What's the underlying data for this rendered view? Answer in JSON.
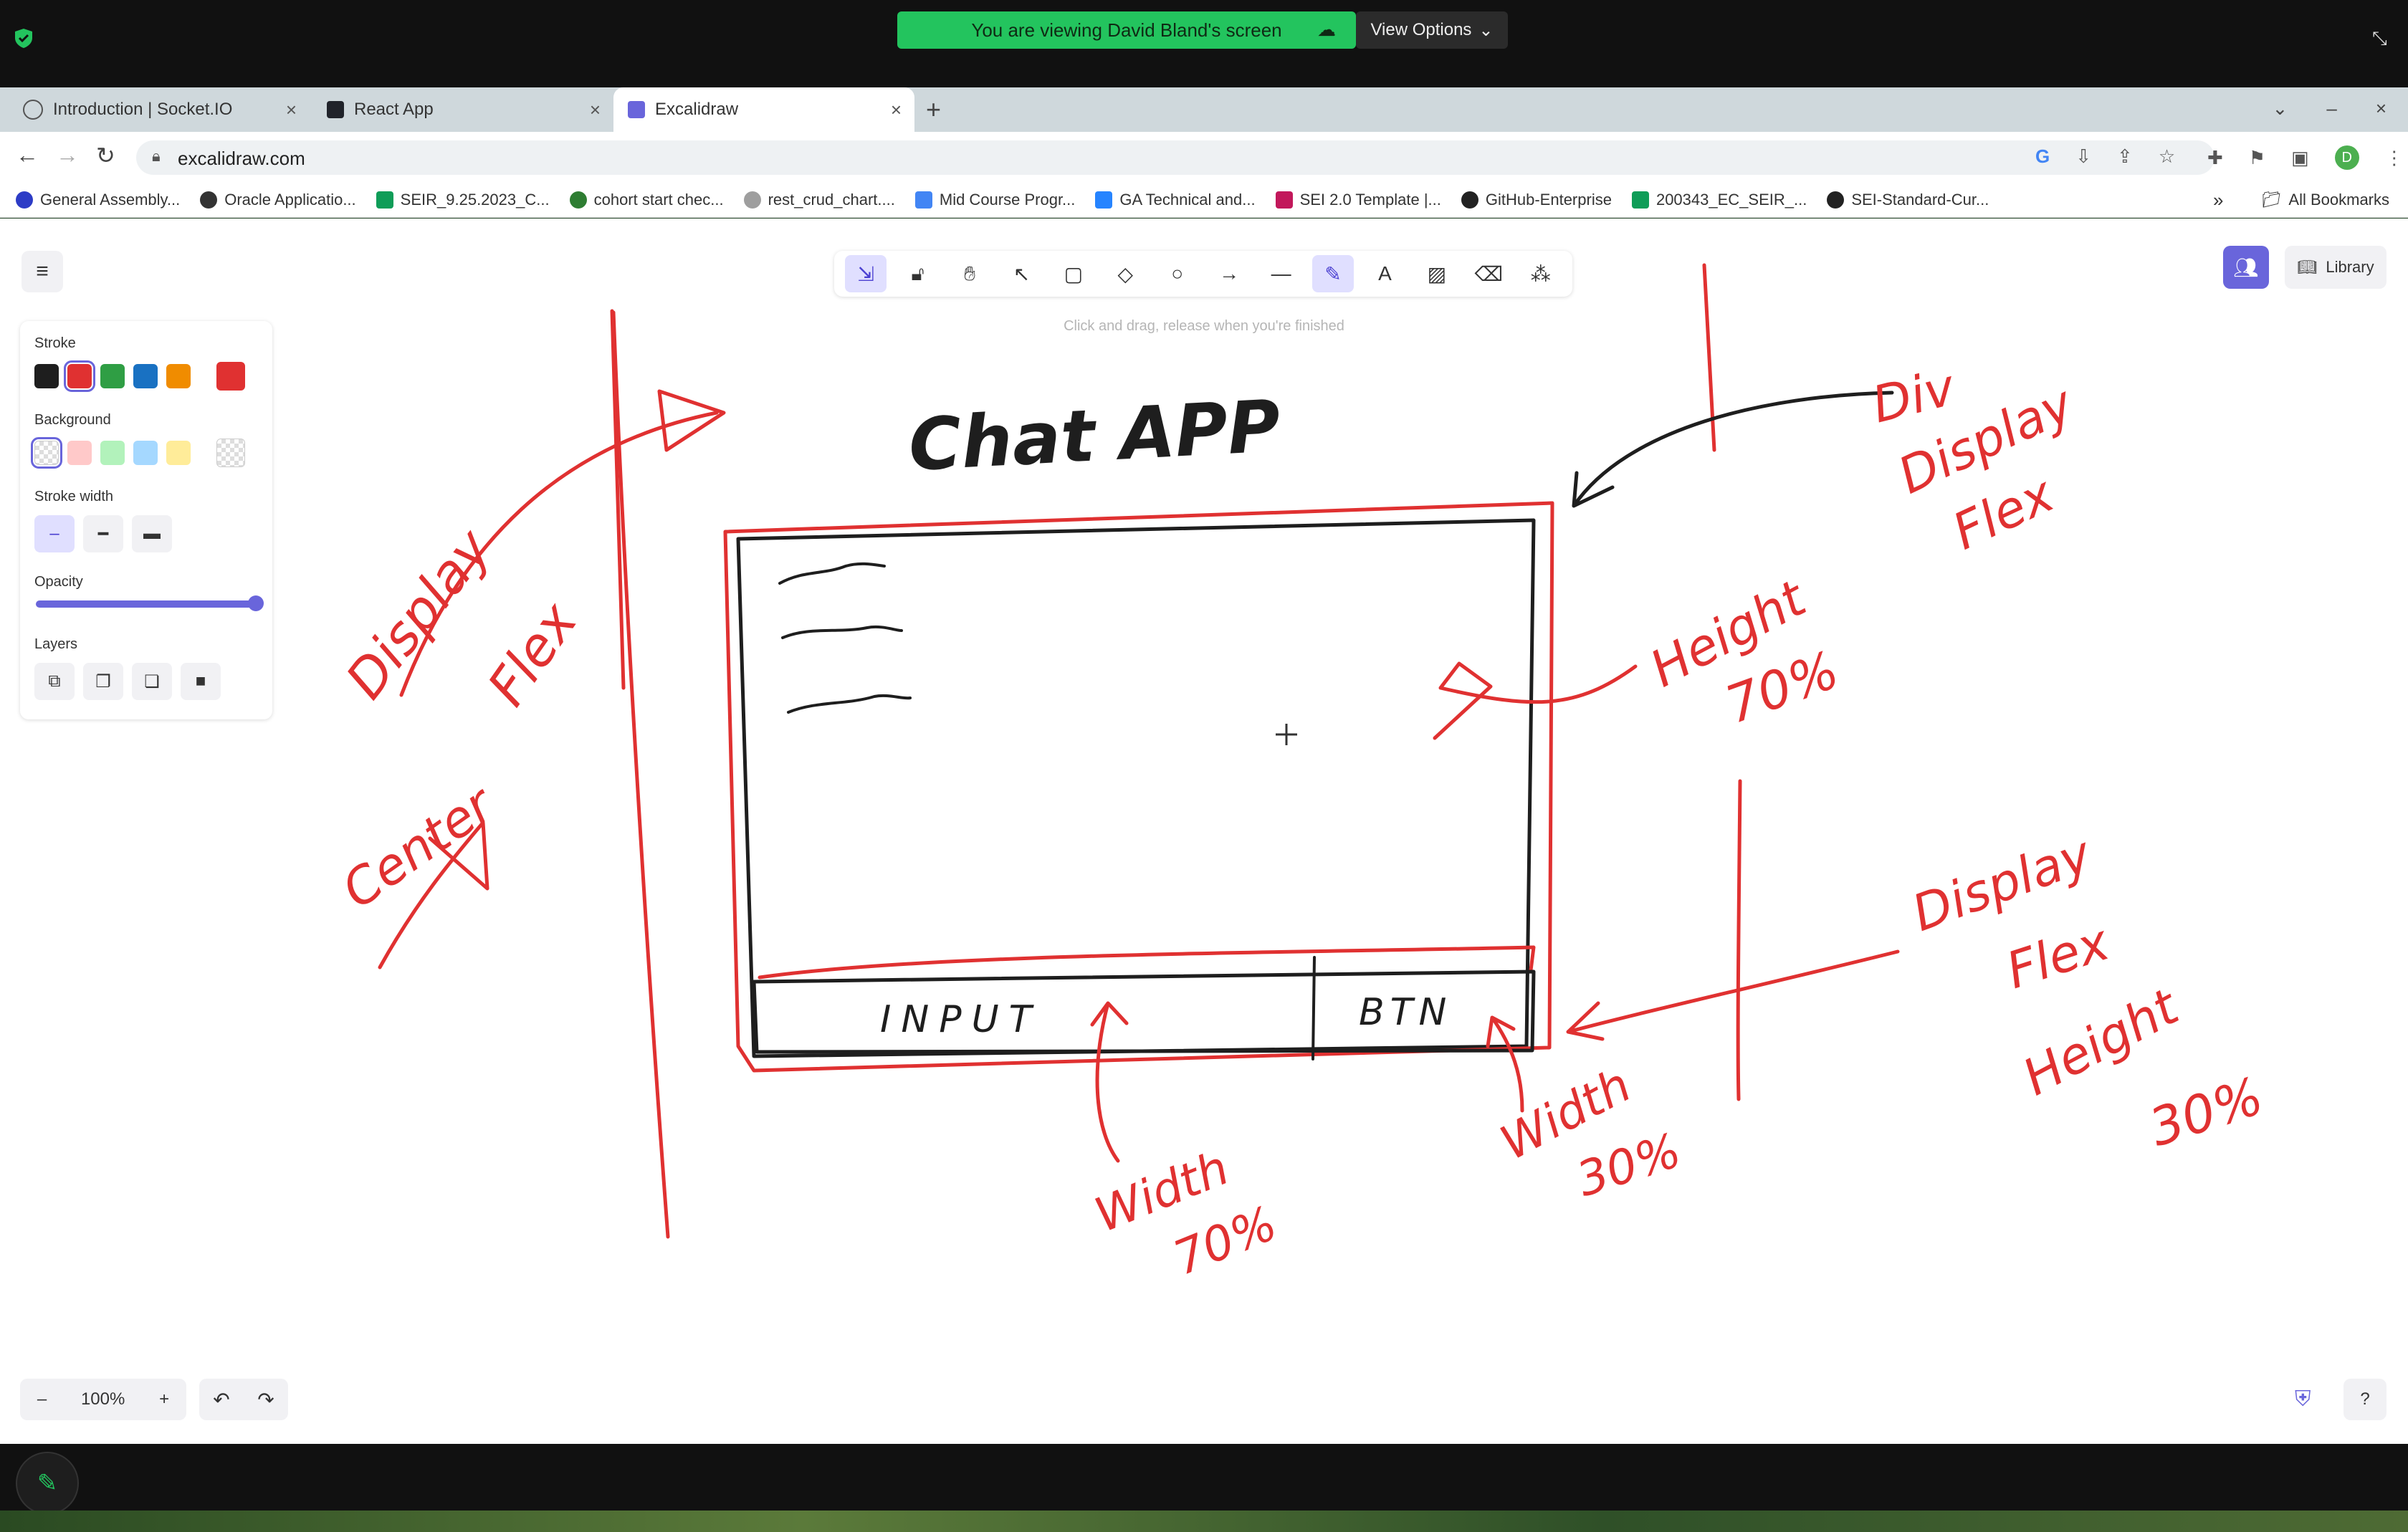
{
  "share": {
    "banner": "You are viewing David Bland's screen",
    "view_options": "View Options"
  },
  "browser": {
    "tabs": [
      {
        "label": "Introduction | Socket.IO",
        "icon": "socketio-icon"
      },
      {
        "label": "React App",
        "icon": "react-icon"
      },
      {
        "label": "Excalidraw",
        "icon": "excalidraw-icon",
        "active": true
      }
    ],
    "url": "excalidraw.com",
    "bookmarks": [
      {
        "label": "General Assembly...",
        "color": "#2d3cc6"
      },
      {
        "label": "Oracle Applicatio...",
        "color": "#333333"
      },
      {
        "label": "SEIR_9.25.2023_C...",
        "color": "#0f9d58"
      },
      {
        "label": "cohort start chec...",
        "color": "#2e7d32"
      },
      {
        "label": "rest_crud_chart....",
        "color": "#9e9e9e"
      },
      {
        "label": "Mid Course Progr...",
        "color": "#4285f4"
      },
      {
        "label": "GA Technical and...",
        "color": "#2684ff"
      },
      {
        "label": "SEI 2.0 Template |...",
        "color": "#c2185b"
      },
      {
        "label": "GitHub-Enterprise",
        "color": "#222222"
      },
      {
        "label": "200343_EC_SEIR_...",
        "color": "#0f9d58"
      },
      {
        "label": "SEI-Standard-Cur...",
        "color": "#222222"
      }
    ],
    "all_bookmarks": "All Bookmarks",
    "profile_initial": "D"
  },
  "excalidraw": {
    "hint": "Click and drag, release when you're finished",
    "library": "Library",
    "props": {
      "stroke": "Stroke",
      "background": "Background",
      "stroke_width": "Stroke width",
      "opacity": "Opacity",
      "layers": "Layers",
      "stroke_colors": [
        "#1e1e1e",
        "#e03131",
        "#2f9e44",
        "#1971c2",
        "#f08c00"
      ],
      "current_stroke": "#e03131",
      "background_colors": [
        "transparent",
        "#ffc9c9",
        "#b2f2bb",
        "#a5d8ff",
        "#ffec99"
      ],
      "opacity_value": 100
    },
    "zoom": "100%"
  },
  "sketch": {
    "title": "Chat APP",
    "input_label": "INPUT",
    "btn_label": "BTN",
    "left_1": "Display",
    "left_2": "Flex",
    "left_3": "Center",
    "right_1": "Div",
    "right_2": "Display",
    "right_3": "Flex",
    "height_70a": "Height",
    "height_70b": "70%",
    "df_1": "Display",
    "df_2": "Flex",
    "df_3": "Height",
    "df_4": "30%",
    "w70a": "Width",
    "w70b": "70%",
    "w30a": "Width",
    "w30b": "30%",
    "stroke_red": "#e03131",
    "stroke_black": "#1e1e1e"
  }
}
